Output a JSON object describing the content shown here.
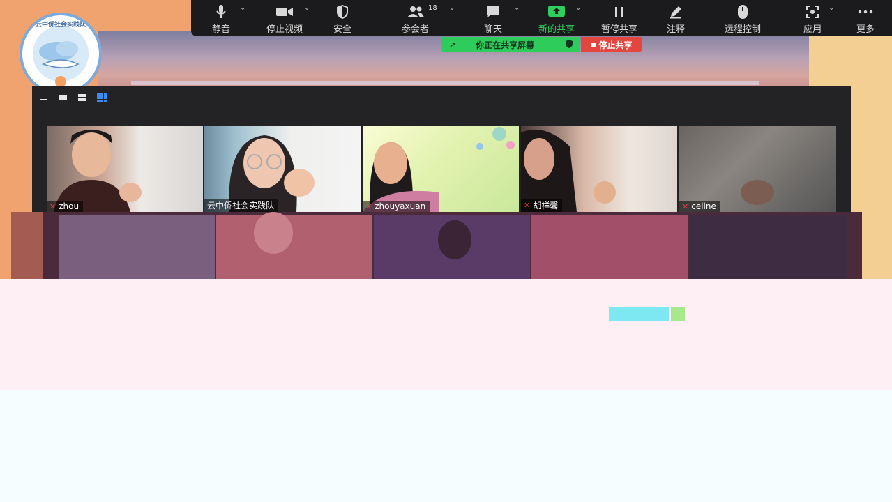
{
  "colors": {
    "toolbar_bg": "#1b1b1d",
    "share_green": "#2ecc5b",
    "stop_red": "#e2463e",
    "gallery_bg": "#232326",
    "logo_ring": "#7ea9d8"
  },
  "logo": {
    "text": "云中侨社会实践队"
  },
  "toolbar": {
    "items": [
      {
        "label": "静音",
        "icon": "microphone-icon"
      },
      {
        "label": "停止视频",
        "icon": "video-camera-icon"
      },
      {
        "label": "安全",
        "icon": "shield-icon"
      },
      {
        "label": "参会者",
        "icon": "participants-icon",
        "count": "18"
      },
      {
        "label": "聊天",
        "icon": "chat-bubble-icon"
      },
      {
        "label": "新的共享",
        "icon": "share-screen-icon"
      },
      {
        "label": "暂停共享",
        "icon": "pause-icon"
      },
      {
        "label": "注释",
        "icon": "pencil-icon"
      },
      {
        "label": "远程控制",
        "icon": "mouse-icon"
      },
      {
        "label": "应用",
        "icon": "apps-icon"
      },
      {
        "label": "更多",
        "icon": "more-dots-icon"
      }
    ]
  },
  "share_banner": {
    "text": "你正在共享屏幕",
    "stop_label": "停止共享"
  },
  "participants": [
    {
      "name": "zhou"
    },
    {
      "name": "云中侨社会实践队"
    },
    {
      "name": "zhouyaxuan"
    },
    {
      "name": "胡祥馨"
    },
    {
      "name": "celine"
    }
  ]
}
